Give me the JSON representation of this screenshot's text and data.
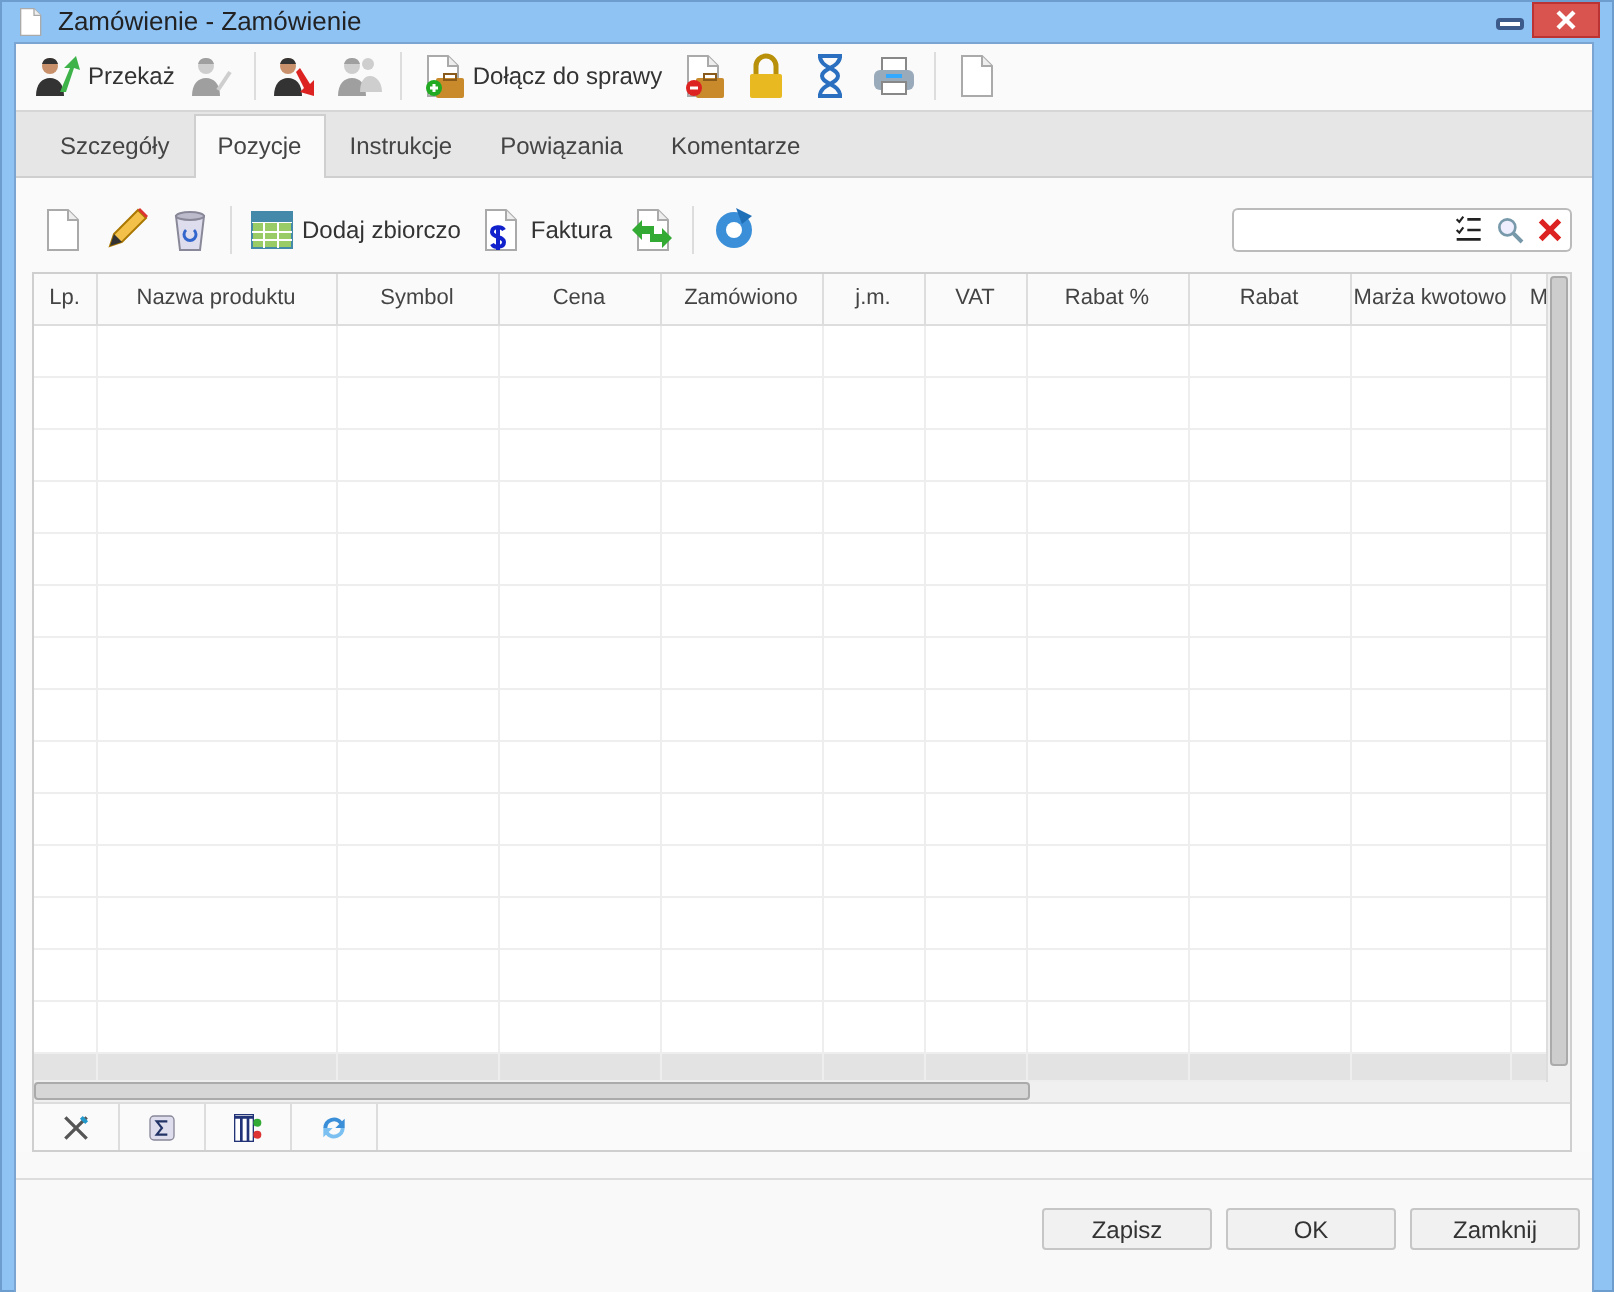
{
  "window": {
    "title": "Zamówienie - Zamówienie"
  },
  "toolbar": [
    {
      "label": "Przekaż",
      "disabled": false
    },
    {
      "disabled": true
    },
    {
      "disabled": false
    },
    {
      "disabled": true
    },
    {
      "label": "Dołącz do sprawy",
      "disabled": false
    },
    {
      "disabled": false
    },
    {
      "disabled": false
    },
    {
      "disabled": false
    },
    {
      "disabled": false
    },
    {
      "disabled": false
    }
  ],
  "tabs": [
    {
      "label": "Szczegóły",
      "selected": false
    },
    {
      "label": "Pozycje",
      "selected": true
    },
    {
      "label": "Instrukcje",
      "selected": false
    },
    {
      "label": "Powiązania",
      "selected": false
    },
    {
      "label": "Komentarze",
      "selected": false
    }
  ],
  "items_toolbar": [
    {
      "label": "Dodaj zbiorczo"
    },
    {
      "label": "Faktura"
    }
  ],
  "table": {
    "columns": [
      "Lp.",
      "Nazwa produktu",
      "Symbol",
      "Cena",
      "Zamówiono",
      "j.m.",
      "VAT",
      "Rabat %",
      "Rabat",
      "Marża kwotowo",
      "M"
    ]
  },
  "buttons": [
    "Zapisz",
    "OK",
    "Zamknij"
  ]
}
